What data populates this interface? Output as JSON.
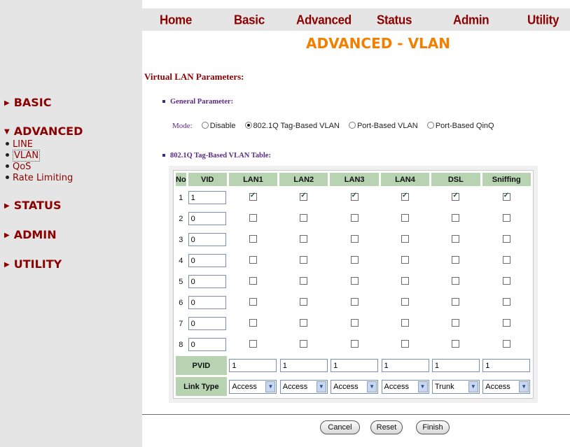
{
  "nav": {
    "home": "Home",
    "basic": "Basic",
    "advanced": "Advanced",
    "status": "Status",
    "admin": "Admin",
    "utility": "Utility"
  },
  "page_title": "ADVANCED - VLAN",
  "section_title": "Virtual LAN Parameters:",
  "general_heading": "General Parameter:",
  "mode": {
    "label": "Mode:",
    "options": [
      "Disable",
      "802.1Q Tag-Based VLAN",
      "Port-Based VLAN",
      "Port-Based QinQ"
    ],
    "selected": "802.1Q Tag-Based VLAN"
  },
  "table_heading": "802.1Q Tag-Based VLAN Table:",
  "sidebar": {
    "basic": "BASIC",
    "advanced": "ADVANCED",
    "advanced_items": [
      "LINE",
      "VLAN",
      "QoS",
      "Rate Limiting"
    ],
    "active_item": "VLAN",
    "status": "STATUS",
    "admin": "ADMIN",
    "utility": "UTILITY"
  },
  "table": {
    "headers": [
      "No",
      "VID",
      "LAN1",
      "LAN2",
      "LAN3",
      "LAN4",
      "DSL",
      "Sniffing"
    ],
    "rows": [
      {
        "no": "1",
        "vid": "1",
        "checks": [
          true,
          true,
          true,
          true,
          true,
          true
        ]
      },
      {
        "no": "2",
        "vid": "0",
        "checks": [
          false,
          false,
          false,
          false,
          false,
          false
        ]
      },
      {
        "no": "3",
        "vid": "0",
        "checks": [
          false,
          false,
          false,
          false,
          false,
          false
        ]
      },
      {
        "no": "4",
        "vid": "0",
        "checks": [
          false,
          false,
          false,
          false,
          false,
          false
        ]
      },
      {
        "no": "5",
        "vid": "0",
        "checks": [
          false,
          false,
          false,
          false,
          false,
          false
        ]
      },
      {
        "no": "6",
        "vid": "0",
        "checks": [
          false,
          false,
          false,
          false,
          false,
          false
        ]
      },
      {
        "no": "7",
        "vid": "0",
        "checks": [
          false,
          false,
          false,
          false,
          false,
          false
        ]
      },
      {
        "no": "8",
        "vid": "0",
        "checks": [
          false,
          false,
          false,
          false,
          false,
          false
        ]
      }
    ],
    "pvid_label": "PVID",
    "pvid_values": [
      "1",
      "1",
      "1",
      "1",
      "1",
      "1"
    ],
    "link_type_label": "Link Type",
    "link_types": [
      "Access",
      "Access",
      "Access",
      "Access",
      "Trunk",
      "Access"
    ]
  },
  "buttons": {
    "cancel": "Cancel",
    "reset": "Reset",
    "finish": "Finish"
  },
  "colors": {
    "brand_red": "#8b0000",
    "title_orange": "#f28000",
    "header_green": "#b7d3b2",
    "sidebar_gray": "#e5e5e5"
  }
}
